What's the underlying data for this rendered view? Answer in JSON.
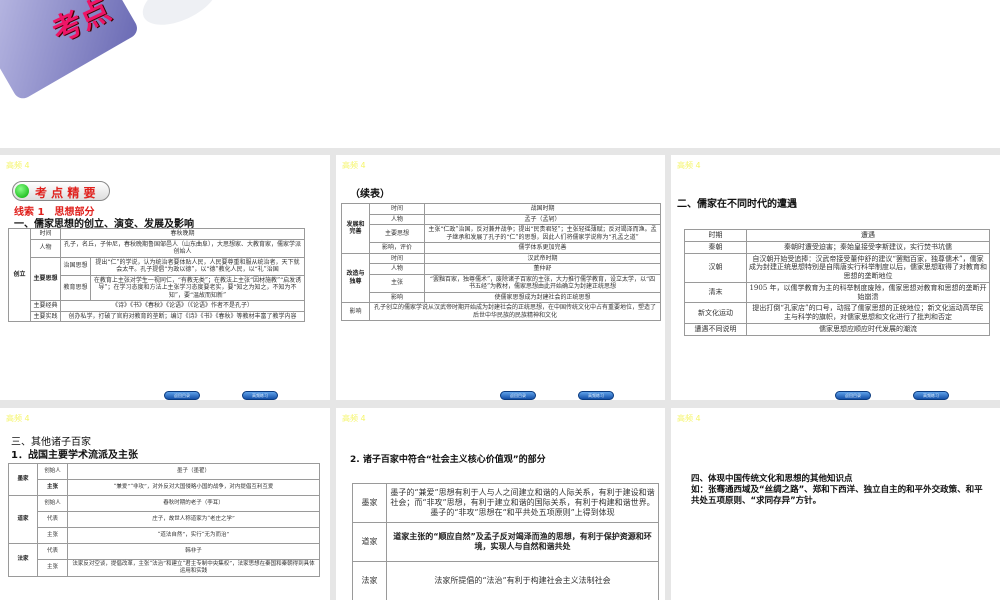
{
  "slide0": {
    "badge": "考点"
  },
  "tag": "高频 4",
  "nav": [
    "返回目录",
    "高频练习"
  ],
  "s1": {
    "pill": "考 点 精 要",
    "clue": "线索 1　思想部分",
    "heading": "一、儒家思想的创立、演变、发展及影响",
    "group": "创立",
    "r_time": "时间",
    "v_time": "春秋晚期",
    "r_person": "人物",
    "v_person": "孔子，名丘，子仲尼，春秋晚期鲁国邹邑人（山东曲阜），大思想家、大教育家，儒家学派创始人",
    "r_idea": "主要思想",
    "r_gov": "治国思想",
    "v_gov": "提出“仁”的学说，认为统治者要体贴人民，人民要尊重和服从统治者，天下就会太平。孔子提倡“为政以德”，以“德”教化人民，以“礼”治国",
    "r_edu": "教育思想",
    "v_edu": "在教育上主张对学生一视同仁，“有教无类”；在教法上主张“因材施教”“启发诱导”；在学习态度和方法上主张学习态度要老实，要“知之为知之，不知为不知”，要“温故而知新”",
    "r_books": "主要经典",
    "v_books": "《诗》《书》《春秋》《论语》（《论语》作者不是孔子）",
    "r_prac": "主要实践",
    "v_prac": "创办私学，打破了官府对教育的垄断；编订《诗》《书》《春秋》等教材丰富了教学内容"
  },
  "s2": {
    "heading": "（续表）",
    "g1": "发展和完善",
    "g2": "改造与独尊",
    "g3": "影响",
    "rows1": [
      [
        "时间",
        "战国时期"
      ],
      [
        "人物",
        "孟子（孟轲）"
      ],
      [
        "主要思想",
        "主张“仁政”治国，反对兼并战争；提出“民贵君轻”；主张轻徭薄赋；反对竭泽而渔。孟子继承和发展了孔子的“仁”的思想，因此人们将儒家学说称为“孔孟之道”"
      ],
      [
        "影响，评价",
        "儒学体系更加完善"
      ]
    ],
    "rows2": [
      [
        "时间",
        "汉武帝时期"
      ],
      [
        "人物",
        "董仲舒"
      ],
      [
        "主张",
        "“罢黜百家，独尊儒术”，废除诸子百家的主张，大力推行儒学教育，设立太学，以“四书五经”为教材，儒家思想由此开始确立为封建正统思想"
      ],
      [
        "影响",
        "使儒家思想成为封建社会的正统思想"
      ]
    ],
    "v3": "孔子创立的儒家学说从汉武帝时期开始成为封建社会的正统思想，在中国传统文化中占有重要地位，塑造了后世中华民族的民族精神和文化"
  },
  "s3": {
    "heading": "二、儒家在不同时代的遭遇",
    "header": [
      "时期",
      "遭遇"
    ],
    "rows": [
      [
        "秦朝",
        "秦朝时遭受迫害；秦始皇接受李斯建议，实行焚书坑儒"
      ],
      [
        "汉朝",
        "自汉朝开始受追捧：汉武帝接受董仲舒的建议“罢黜百家，独尊儒术”，儒家成为封建正统思想特别是自隋唐实行科举制度以后，儒家思想取得了对教育和思想的垄断地位"
      ],
      [
        "清末",
        "1905 年，以儒学教育为主的科举制度废除，儒家思想对教育和思想的垄断开始崩溃"
      ],
      [
        "新文化运动",
        "提出打倒“孔家店”的口号，动摇了儒家思想的正统地位；新文化运动高举民主与科学的旗帜，对儒家思想和文化进行了批判和否定"
      ],
      [
        "遭遇不同说明",
        "儒家思想应顺应时代发展的潮流"
      ]
    ]
  },
  "s4": {
    "heading1": "三、其他诸子百家",
    "heading2": "1．战国主要学术流派及主张",
    "schools": [
      {
        "name": "墨家",
        "rows": [
          [
            "创始人",
            "墨子（墨翟）"
          ],
          [
            "主张",
            "“兼爱”“非攻”，对外反对大国侵略小国的战争，对内提倡互利互爱"
          ]
        ]
      },
      {
        "name": "道家",
        "rows": [
          [
            "创始人",
            "春秋时期的老子（李耳）"
          ],
          [
            "代表",
            "庄子，故世人称道家为“老庄之学”"
          ],
          [
            "主张",
            "“道法自然”，实行“无为而治”"
          ]
        ]
      },
      {
        "name": "法家",
        "rows": [
          [
            "代表",
            "韩非子"
          ],
          [
            "主张",
            "法家反对空谈，提倡改革，主张“法治”和建立“君主专制中央集权”，法家思想在秦国和秦朝得到具体运用和实践"
          ]
        ]
      }
    ]
  },
  "s5": {
    "heading": "2. 诸子百家中符合“社会主义核心价值观”的部分",
    "rows": [
      [
        "墨家",
        "墨子的“兼爱”思想有利于人与人之间建立和谐的人际关系，有利于建设和谐社会；而“非攻”思想，有利于建立和谐的国际关系，有利于构建和谐世界。墨子的“非攻”思想在“和平共处五项原则”上得到体现"
      ],
      [
        "道家",
        "道家主张的“顺应自然”及孟子反对竭泽而渔的思想，有利于保护资源和环境，实现人与自然和谐共处"
      ],
      [
        "法家",
        "法家所提倡的“法治”有利于构建社会主义法制社会"
      ]
    ]
  },
  "s6": {
    "heading": "四、体现中国传统文化和思想的其他知识点",
    "body": "如：张骞通西域及“丝绸之路”、郑和下西洋、独立自主的和平外交政策、和平共处五项原则、“求同存异”方针。"
  }
}
